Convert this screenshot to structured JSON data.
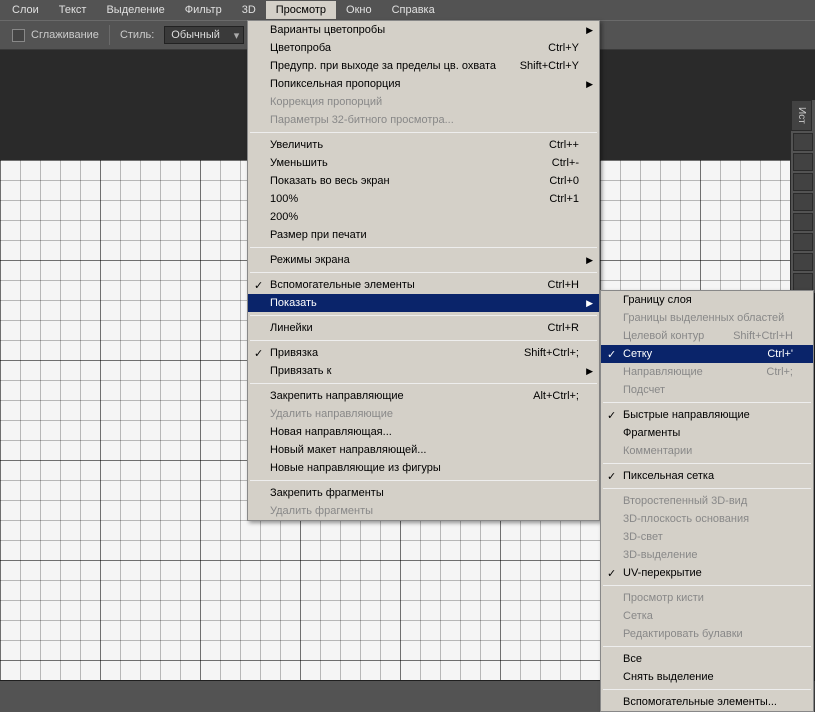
{
  "menubar": {
    "items": [
      "Слои",
      "Текст",
      "Выделение",
      "Фильтр",
      "3D",
      "Просмотр",
      "Окно",
      "Справка"
    ],
    "active_index": 5
  },
  "toolbar": {
    "smoothing_label": "Сглаживание",
    "style_label": "Стиль:",
    "style_value": "Обычный"
  },
  "side_panel": {
    "tab_label": "Ист"
  },
  "menu_view": {
    "groups": [
      [
        {
          "label": "Варианты цветопробы",
          "arrow": true
        },
        {
          "label": "Цветопроба",
          "shortcut": "Ctrl+Y"
        },
        {
          "label": "Предупр. при выходе за пределы цв. охвата",
          "shortcut": "Shift+Ctrl+Y"
        },
        {
          "label": "Попиксельная пропорция",
          "arrow": true
        },
        {
          "label": "Коррекция пропорций",
          "disabled": true
        },
        {
          "label": "Параметры 32-битного просмотра...",
          "disabled": true
        }
      ],
      [
        {
          "label": "Увеличить",
          "shortcut": "Ctrl++"
        },
        {
          "label": "Уменьшить",
          "shortcut": "Ctrl+-"
        },
        {
          "label": "Показать во весь экран",
          "shortcut": "Ctrl+0"
        },
        {
          "label": "100%",
          "shortcut": "Ctrl+1"
        },
        {
          "label": "200%"
        },
        {
          "label": "Размер при печати"
        }
      ],
      [
        {
          "label": "Режимы экрана",
          "arrow": true
        }
      ],
      [
        {
          "label": "Вспомогательные элементы",
          "shortcut": "Ctrl+H",
          "checked": true
        },
        {
          "label": "Показать",
          "arrow": true,
          "highlighted": true
        }
      ],
      [
        {
          "label": "Линейки",
          "shortcut": "Ctrl+R"
        }
      ],
      [
        {
          "label": "Привязка",
          "shortcut": "Shift+Ctrl+;",
          "checked": true
        },
        {
          "label": "Привязать к",
          "arrow": true
        }
      ],
      [
        {
          "label": "Закрепить направляющие",
          "shortcut": "Alt+Ctrl+;"
        },
        {
          "label": "Удалить направляющие",
          "disabled": true
        },
        {
          "label": "Новая направляющая..."
        },
        {
          "label": "Новый макет направляющей..."
        },
        {
          "label": "Новые направляющие из фигуры"
        }
      ],
      [
        {
          "label": "Закрепить фрагменты"
        },
        {
          "label": "Удалить фрагменты",
          "disabled": true
        }
      ]
    ]
  },
  "menu_show": {
    "groups": [
      [
        {
          "label": "Границу слоя"
        },
        {
          "label": "Границы выделенных областей",
          "disabled": true
        },
        {
          "label": "Целевой контур",
          "shortcut": "Shift+Ctrl+H",
          "disabled": true
        },
        {
          "label": "Сетку",
          "shortcut": "Ctrl+'",
          "checked": true,
          "highlighted": true
        },
        {
          "label": "Направляющие",
          "shortcut": "Ctrl+;",
          "disabled": true
        },
        {
          "label": "Подсчет",
          "disabled": true
        }
      ],
      [
        {
          "label": "Быстрые направляющие",
          "checked": true
        },
        {
          "label": "Фрагменты"
        },
        {
          "label": "Комментарии",
          "disabled": true
        }
      ],
      [
        {
          "label": "Пиксельная сетка",
          "checked": true
        }
      ],
      [
        {
          "label": "Второстепенный 3D-вид",
          "disabled": true
        },
        {
          "label": "3D-плоскость основания",
          "disabled": true
        },
        {
          "label": "3D-свет",
          "disabled": true
        },
        {
          "label": "3D-выделение",
          "disabled": true
        },
        {
          "label": "UV-перекрытие",
          "checked": true
        }
      ],
      [
        {
          "label": "Просмотр кисти",
          "disabled": true
        },
        {
          "label": "Сетка",
          "disabled": true
        },
        {
          "label": "Редактировать булавки",
          "disabled": true
        }
      ],
      [
        {
          "label": "Все"
        },
        {
          "label": "Снять выделение"
        }
      ],
      [
        {
          "label": "Вспомогательные элементы..."
        }
      ]
    ]
  }
}
